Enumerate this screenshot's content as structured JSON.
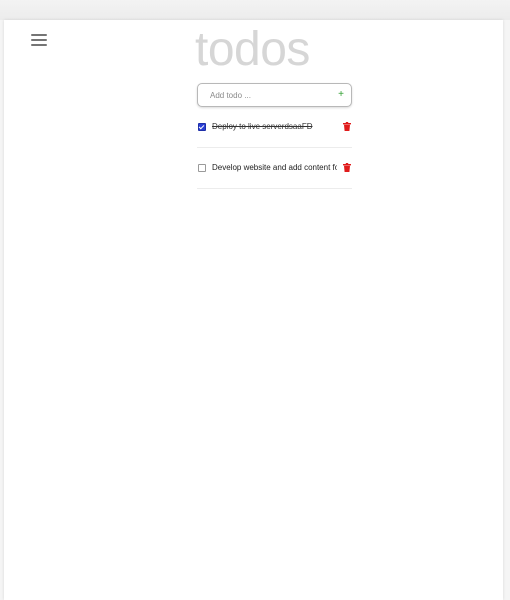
{
  "app": {
    "title": "todos"
  },
  "header": {
    "menu_icon": "hamburger-menu-icon"
  },
  "add_todo": {
    "placeholder": "Add todo ...",
    "value": "",
    "add_button_label": "+"
  },
  "todos": [
    {
      "text": "Deploy to live serverdsaaFD",
      "completed": true,
      "delete_icon": "trash-icon"
    },
    {
      "text": "Develop website and add content for",
      "completed": false,
      "delete_icon": "trash-icon"
    }
  ],
  "colors": {
    "accent_add": "#2e9e2e",
    "delete": "#e01b1b",
    "title": "#d6d6d6",
    "checkbox_checked": "#2a3fd4"
  }
}
